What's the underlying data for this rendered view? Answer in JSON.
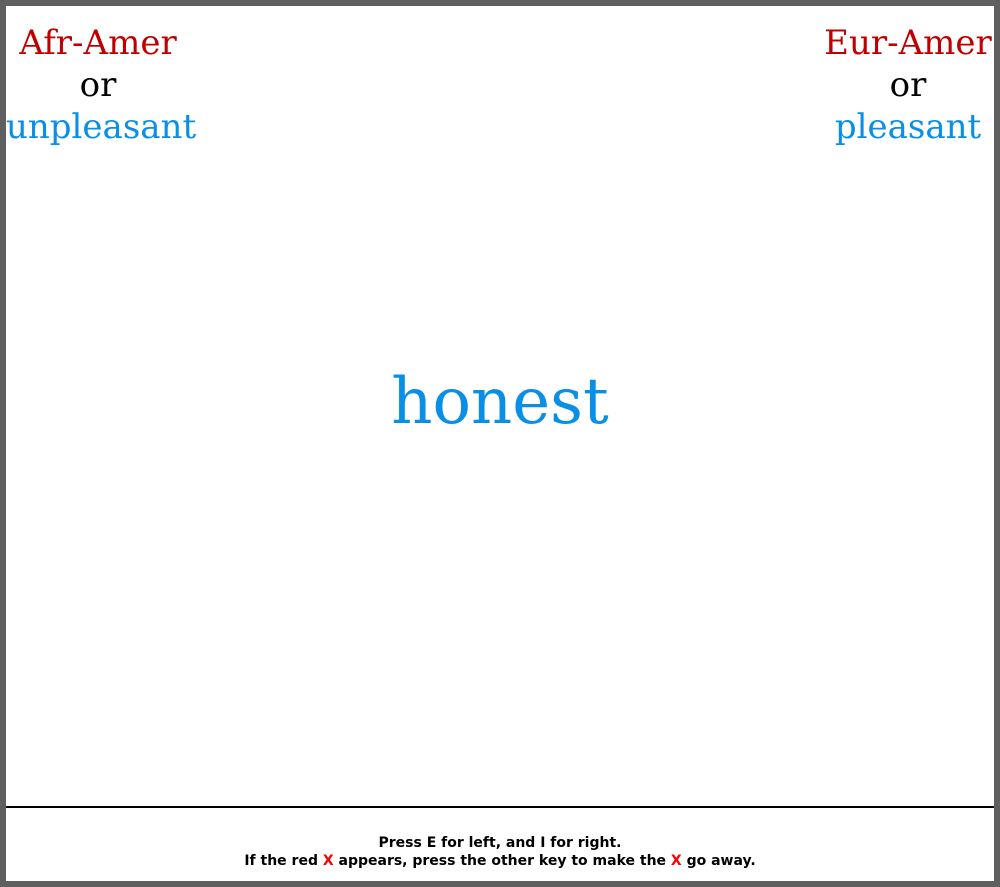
{
  "colors": {
    "category": "#c00000",
    "connector": "#000000",
    "attribute": "#0a8fe6",
    "error_x": "#ff0000"
  },
  "left": {
    "category": "Afr-Amer",
    "connector": "or",
    "attribute": "unpleasant"
  },
  "right": {
    "category": "Eur-Amer",
    "connector": "or",
    "attribute": "pleasant"
  },
  "stimulus": {
    "word": "honest"
  },
  "footer": {
    "instruction_line1": "Press E for left, and I for right.",
    "line2_part1": "If the red ",
    "line2_x": "X",
    "line2_part2": " appears, press the other key to make the ",
    "line2_x2": "X",
    "line2_part3": " go away."
  }
}
